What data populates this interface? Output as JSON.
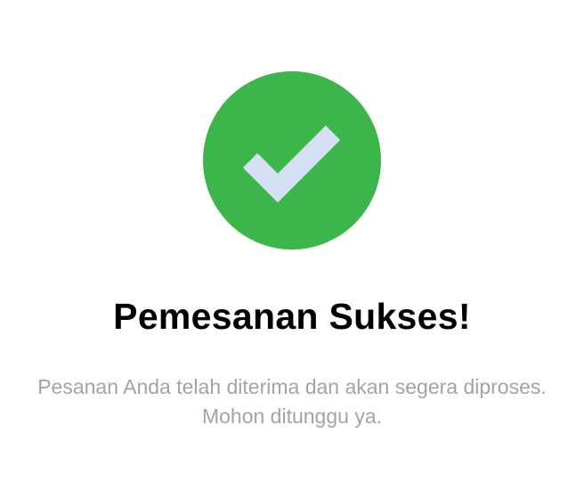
{
  "colors": {
    "success": "#3cb54a",
    "check": "#d5e0f3",
    "title": "#000000",
    "message": "#a3a3a3"
  },
  "icon": "check-circle-icon",
  "title": "Pemesanan Sukses!",
  "message": "Pesanan Anda telah diterima dan akan segera diproses. Mohon ditunggu ya."
}
